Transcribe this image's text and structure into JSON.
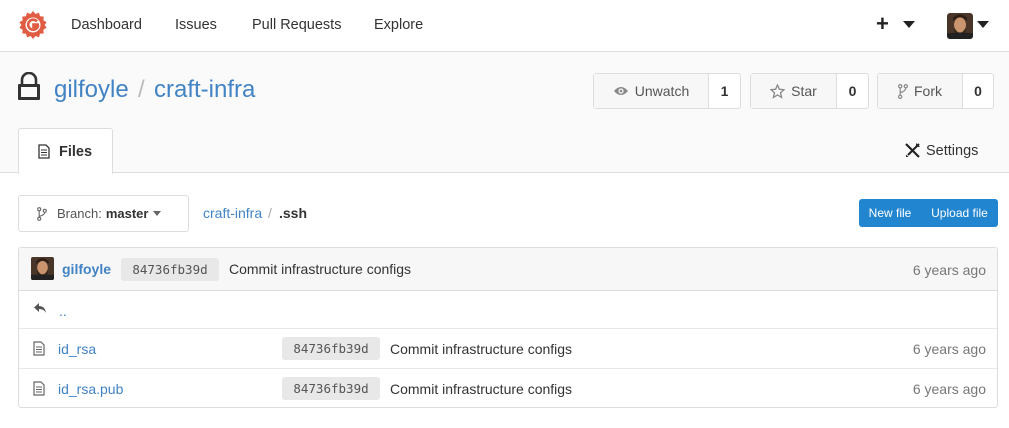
{
  "nav": {
    "items": [
      "Dashboard",
      "Issues",
      "Pull Requests",
      "Explore"
    ],
    "plus_icon": "+",
    "brand_color": "#e05d44"
  },
  "repo": {
    "owner": "gilfoyle",
    "separator": "/",
    "name": "craft-infra",
    "watch": {
      "label": "Unwatch",
      "count": "1"
    },
    "star": {
      "label": "Star",
      "count": "0"
    },
    "fork": {
      "label": "Fork",
      "count": "0"
    }
  },
  "tabs": {
    "files": "Files",
    "settings": "Settings"
  },
  "toolbar": {
    "branch_label": "Branch:",
    "branch_value": "master",
    "breadcrumb_repo": "craft-infra",
    "breadcrumb_sep": "/",
    "breadcrumb_dir": ".ssh",
    "new_file": "New file",
    "upload_file": "Upload file",
    "accent_color": "#2185d0"
  },
  "latest_commit": {
    "author": "gilfoyle",
    "sha": "84736fb39d",
    "message": "Commit infrastructure configs",
    "age": "6 years ago"
  },
  "parent_dir": "..",
  "files": [
    {
      "name": "id_rsa",
      "sha": "84736fb39d",
      "message": "Commit infrastructure configs",
      "age": "6 years ago",
      "icon": "file-text-icon"
    },
    {
      "name": "id_rsa.pub",
      "sha": "84736fb39d",
      "message": "Commit infrastructure configs",
      "age": "6 years ago",
      "icon": "file-text-icon"
    }
  ]
}
